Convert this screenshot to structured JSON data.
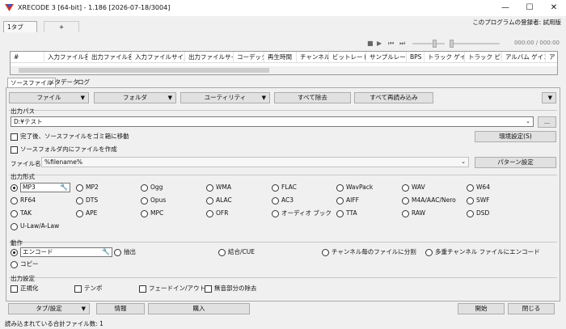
{
  "window": {
    "title": "XRECODE 3 [64-bit] - 1.186 [2026-07-18/3004]",
    "min": "—",
    "max": "☐",
    "close": "✕"
  },
  "registrant": "このプログラムの登録者: 試用版",
  "tabs": [
    "1タブ",
    "+"
  ],
  "player": {
    "time": "000:00 / 000:00"
  },
  "table": {
    "columns": [
      "#",
      "入力ファイル名",
      "出力ファイル名",
      "入力ファイルサイズ",
      "出力ファイルサイズ",
      "コーデック",
      "再生時間",
      "チャンネル",
      "ビットレート",
      "サンプルレート",
      "BPS",
      "トラック ゲイン",
      "トラック ピーク",
      "アルバム ゲイン",
      "ア"
    ]
  },
  "subtabs": [
    "ソースファイル",
    "メタデータ",
    "ログ"
  ],
  "toolbar": {
    "file": "ファイル",
    "folder": "フォルダ",
    "utility": "ユーティリティ",
    "remove_all": "すべて除去",
    "reload_all": "すべて再読み込み"
  },
  "output_path": {
    "title": "出力パス",
    "value": "D:¥テスト",
    "browse": "...",
    "env": "環境設定(S)"
  },
  "options": {
    "move_trash": "完了後、ソースファイルをゴミ箱に移動",
    "create_in_source": "ソースフォルダ内にファイルを作成",
    "filename_label": "ファイル名:",
    "filename_value": "%filename%",
    "pattern": "パターン設定"
  },
  "format": {
    "title": "出力形式",
    "items": [
      [
        "MP3",
        "MP2",
        "Ogg",
        "WMA",
        "FLAC",
        "WavPack",
        "WAV",
        "W64"
      ],
      [
        "RF64",
        "DTS",
        "Opus",
        "ALAC",
        "AC3",
        "AIFF",
        "M4A/AAC/Nero",
        "SWF"
      ],
      [
        "TAK",
        "APE",
        "MPC",
        "OFR",
        "オーディオ ブック",
        "TTA",
        "RAW",
        "DSD"
      ],
      [
        "U-Law/A-Law"
      ]
    ]
  },
  "action": {
    "title": "動作",
    "encode": "エンコード",
    "extract": "抽出",
    "join": "結合/CUE",
    "split": "チャンネル毎のファイルに分割",
    "multi": "多重チャンネル ファイルにエンコード",
    "copy": "コピー"
  },
  "settings": {
    "title": "出力設定",
    "normalize": "正規化",
    "tempo": "テンポ",
    "fade": "フェードイン/アウト",
    "silence": "無音部分の除去"
  },
  "bottom": {
    "tab_settings": "タブ/設定",
    "info": "情報",
    "buy": "購入",
    "start": "開始",
    "close": "閉じる"
  },
  "status": "読み込まれている合計ファイル数: 1",
  "colors": {
    "accent": "#e0301e"
  }
}
